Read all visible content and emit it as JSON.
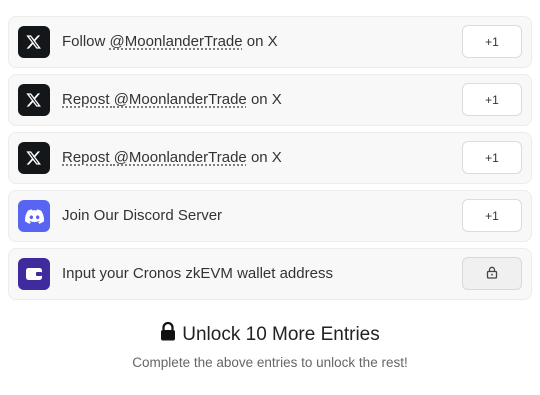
{
  "entries": [
    {
      "prefix": "Follow ",
      "handle": "@MoonlanderTrade",
      "suffix": " on X",
      "action": "+1",
      "icon": "x-logo-icon"
    },
    {
      "prefix": "Repost ",
      "handle": "@MoonlanderTrade",
      "suffix": " on X",
      "action": "+1",
      "icon": "x-logo-icon"
    },
    {
      "prefix": "Repost ",
      "handle": "@MoonlanderTrade",
      "suffix": " on X",
      "action": "+1",
      "icon": "x-logo-icon"
    },
    {
      "label": "Join Our Discord Server",
      "action": "+1",
      "icon": "discord-icon"
    },
    {
      "label": "Input your Cronos zkEVM wallet address",
      "icon": "wallet-icon",
      "action_icon": "lock-icon"
    }
  ],
  "unlock": {
    "title": "Unlock 10 More Entries",
    "subtitle": "Complete the above entries to unlock the rest!"
  },
  "colors": {
    "x": "#14171a",
    "discord": "#5865f2",
    "wallet": "#3f2a9e"
  }
}
